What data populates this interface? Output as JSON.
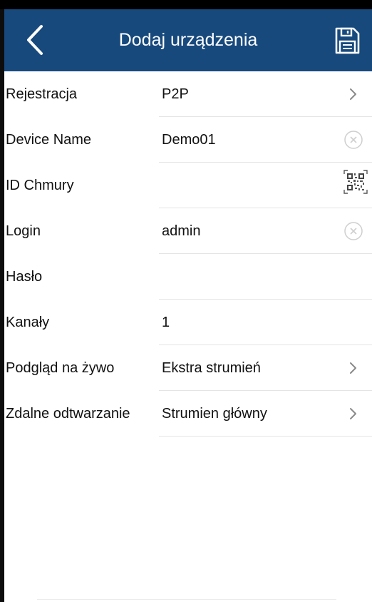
{
  "header": {
    "title": "Dodaj urządzenia",
    "back_icon": "chevron-left-icon",
    "save_icon": "floppy-disk-icon",
    "background": "#17497d"
  },
  "form": {
    "rows": [
      {
        "label": "Rejestracja",
        "value": "P2P",
        "accessory": "chevron-right-icon"
      },
      {
        "label": "Device Name",
        "value": "Demo01",
        "accessory": "clear-icon"
      },
      {
        "label": "ID Chmury",
        "value": "",
        "accessory": "qr-code-icon"
      },
      {
        "label": "Login",
        "value": "admin",
        "accessory": "clear-icon"
      },
      {
        "label": "Hasło",
        "value": ""
      },
      {
        "label": "Kanały",
        "value": "1"
      },
      {
        "label": "Podgląd na żywo",
        "value": "Ekstra strumień",
        "accessory": "chevron-right-icon"
      },
      {
        "label": "Zdalne odtwarzanie",
        "value": "Strumien główny",
        "accessory": "chevron-right-icon"
      }
    ]
  }
}
